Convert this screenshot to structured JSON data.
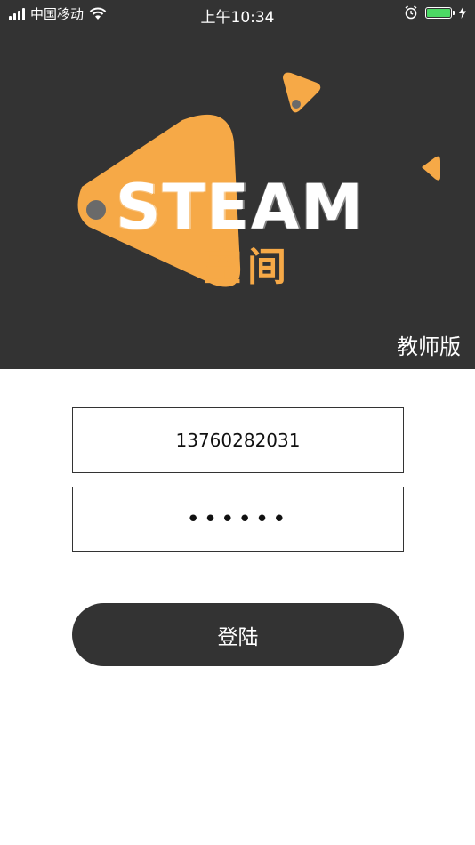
{
  "status_bar": {
    "carrier": "中国移动",
    "time": "上午10:34",
    "battery_color": "#4cd964"
  },
  "logo": {
    "word": "STEAM",
    "subtitle": "空间",
    "accent_color": "#f6a947"
  },
  "edition_label": "教师版",
  "form": {
    "phone_value": "13760282031",
    "password_value": "••••••"
  },
  "login_button_label": "登陆",
  "colors": {
    "header_bg": "#333333",
    "button_bg": "#333333"
  }
}
